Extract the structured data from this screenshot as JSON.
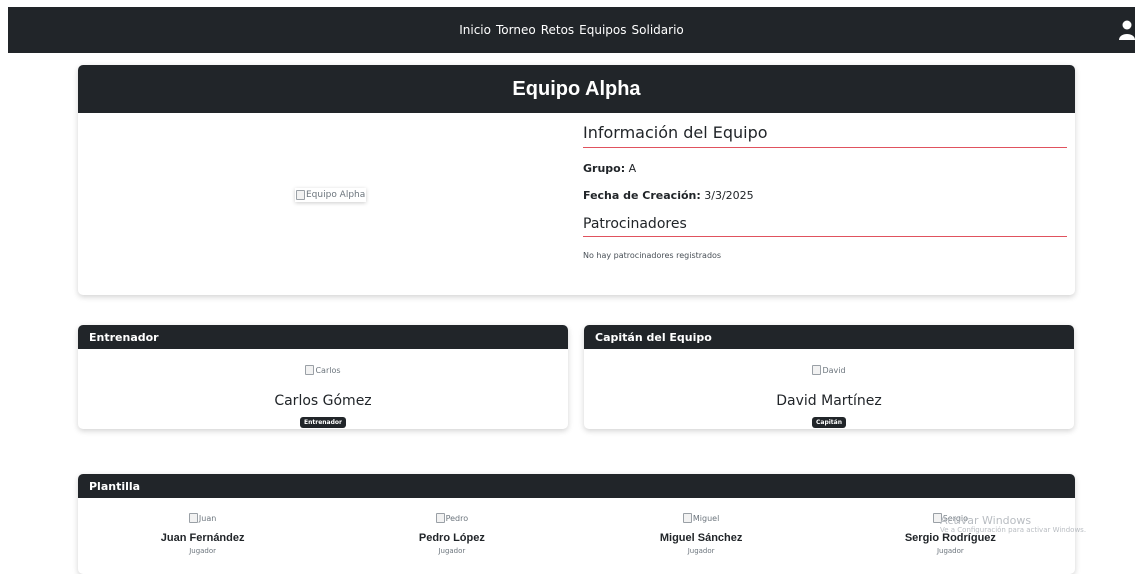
{
  "nav": {
    "items": [
      "Inicio",
      "Torneo",
      "Retos",
      "Equipos",
      "Solidario"
    ],
    "user_icon": "user-icon"
  },
  "team": {
    "name": "Equipo Alpha",
    "image_alt": "Equipo Alpha",
    "info_title": "Información del Equipo",
    "group_label": "Grupo:",
    "group_value": "A",
    "created_label": "Fecha de Creación:",
    "created_value": "3/3/2025",
    "sponsors_title": "Patrocinadores",
    "sponsors_empty": "No hay patrocinadores registrados"
  },
  "coach": {
    "header": "Entrenador",
    "image_alt": "Carlos",
    "name": "Carlos Gómez",
    "badge": "Entrenador"
  },
  "captain": {
    "header": "Capitán del Equipo",
    "image_alt": "David",
    "name": "David Martínez",
    "badge": "Capitán"
  },
  "squad": {
    "header": "Plantilla",
    "players": [
      {
        "image_alt": "Juan",
        "name": "Juan Fernández",
        "role": "Jugador"
      },
      {
        "image_alt": "Pedro",
        "name": "Pedro López",
        "role": "Jugador"
      },
      {
        "image_alt": "Miguel",
        "name": "Miguel Sánchez",
        "role": "Jugador"
      },
      {
        "image_alt": "Sergio",
        "name": "Sergio Rodríguez",
        "role": "Jugador"
      }
    ]
  },
  "watermark": {
    "line1": "Activar Windows",
    "line2": "Ve a Configuración para activar Windows."
  },
  "colors": {
    "navbar": "#212529",
    "accent_line": "#e0525e",
    "badge": "#212529"
  }
}
